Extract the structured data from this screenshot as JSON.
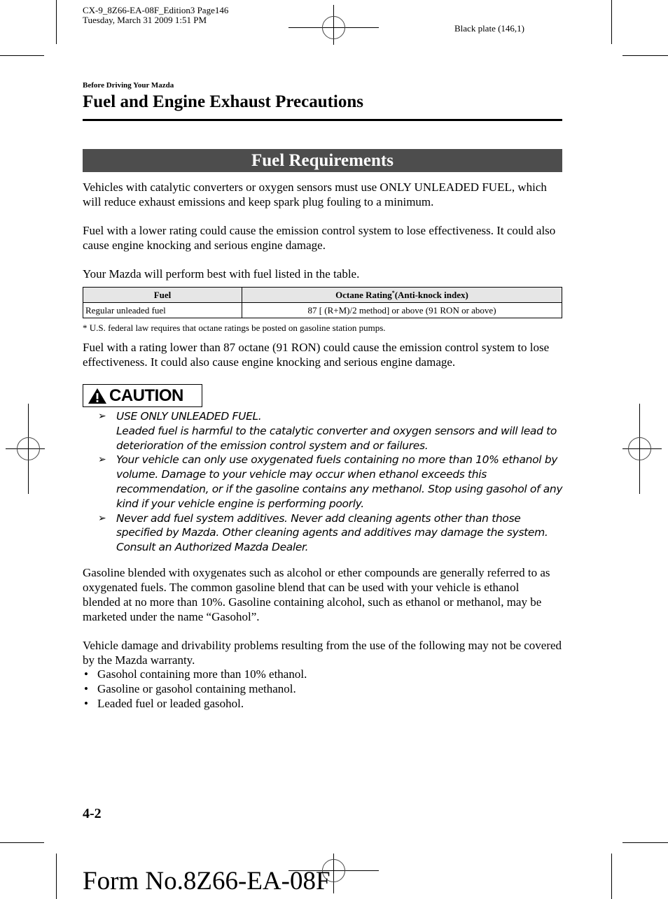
{
  "print_slug": {
    "line1": "CX-9_8Z66-EA-08F_Edition3 Page146",
    "line2": "Tuesday, March 31 2009 1:51 PM",
    "plate": "Black plate (146,1)"
  },
  "header": {
    "breadcrumb": "Before Driving Your Mazda",
    "title": "Fuel and Engine Exhaust Precautions"
  },
  "section": {
    "title": "Fuel Requirements",
    "paragraphs": [
      "Vehicles with catalytic converters or oxygen sensors must use ONLY UNLEADED FUEL, which will reduce exhaust emissions and keep spark plug fouling to a minimum.",
      "Fuel with a lower rating could cause the emission control system to lose effectiveness. It could also cause engine knocking and serious engine damage.",
      "Your Mazda will perform best with fuel listed in the table."
    ]
  },
  "fuel_table": {
    "headers": {
      "fuel": "Fuel",
      "octane_main": "Octane Rating",
      "octane_mark": "*",
      "octane_suffix": "(Anti-knock index)"
    },
    "rows": [
      {
        "fuel": "Regular unleaded fuel",
        "octane": "87 [ (R+M)/2 method] or above (91 RON or above)"
      }
    ],
    "footnote": "*  U.S. federal law requires that octane ratings be posted on gasoline station pumps."
  },
  "after_table": "Fuel with a rating lower than 87 octane (91 RON) could cause the emission control system to lose effectiveness. It could also cause engine knocking and serious engine damage.",
  "caution": {
    "label": "CAUTION",
    "icon": "warning-triangle-icon",
    "bullet_glyph": "➢",
    "items": [
      {
        "lead": "USE ONLY UNLEADED FUEL.",
        "text": "Leaded fuel is harmful to the catalytic converter and oxygen sensors and will lead to deterioration of the emission control system and or failures."
      },
      {
        "lead": "",
        "text": "Your vehicle can only use oxygenated fuels containing no more than 10% ethanol by volume. Damage to your vehicle may occur when ethanol exceeds this recommendation, or if the gasoline contains any methanol. Stop using gasohol of any kind if your vehicle engine is performing poorly."
      },
      {
        "lead": "",
        "text": "Never add fuel system additives. Never add cleaning agents other than those specified by Mazda. Other cleaning agents and additives may damage the system. Consult an Authorized Mazda Dealer."
      }
    ]
  },
  "oxygenates": {
    "paragraph1": "Gasoline blended with oxygenates such as alcohol or ether compounds are generally referred to as oxygenated fuels. The common gasoline blend that can be used with your vehicle is ethanol blended at no more than 10%. Gasoline containing alcohol, such as ethanol or methanol, may be marketed under the name “Gasohol”.",
    "paragraph2": "Vehicle damage and drivability problems resulting from the use of the following may not be covered by the Mazda warranty.",
    "bullet_glyph": "•",
    "bullets": [
      "Gasohol containing more than 10% ethanol.",
      "Gasoline or gasohol containing methanol.",
      "Leaded fuel or leaded gasohol."
    ]
  },
  "footer": {
    "page_number": "4-2",
    "form_number": "Form No.8Z66-EA-08F"
  }
}
